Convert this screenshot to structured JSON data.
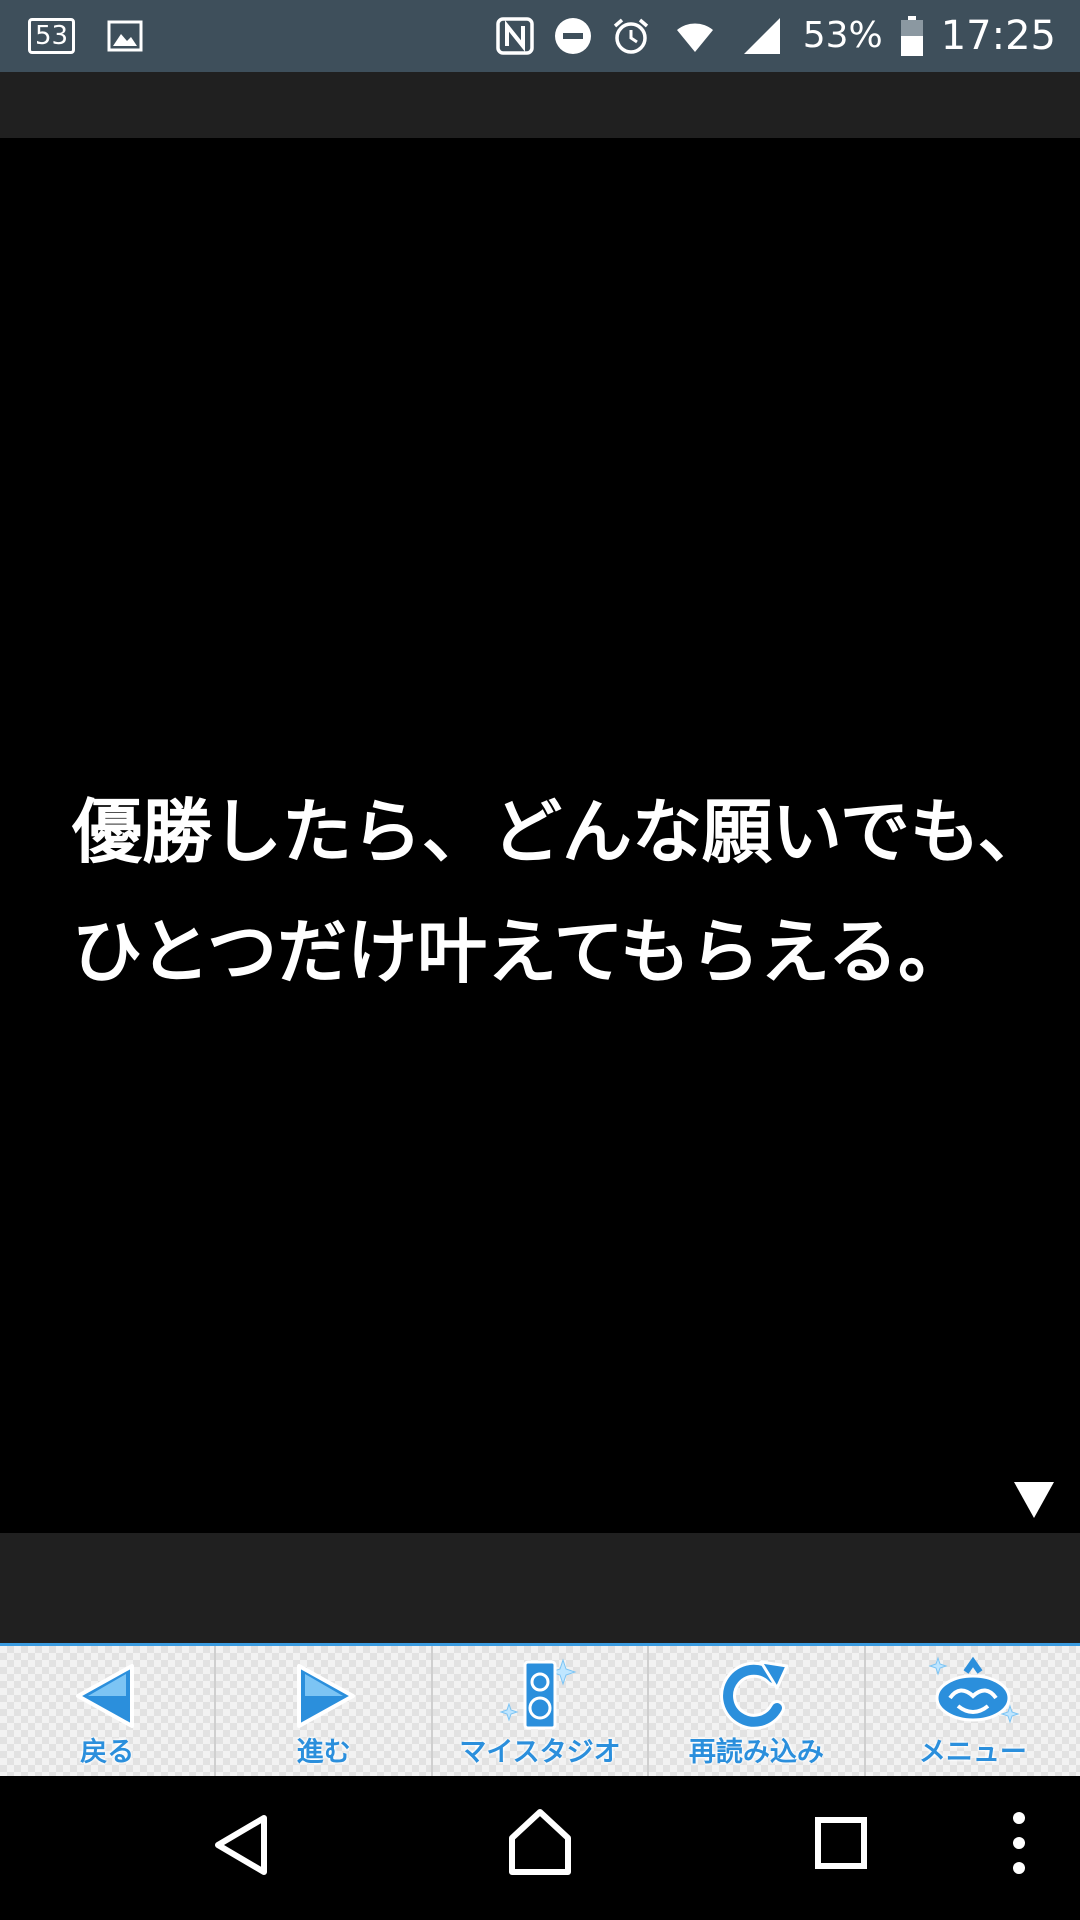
{
  "status_bar": {
    "notification_count": "53",
    "battery_percent": "53%",
    "time": "17:25",
    "icons": [
      "notification-count-icon",
      "gallery-icon",
      "nfc-icon",
      "do-not-disturb-icon",
      "alarm-icon",
      "wifi-icon",
      "signal-icon",
      "battery-icon"
    ]
  },
  "story": {
    "lines": [
      "優勝したら、どんな願いでも、",
      "ひとつだけ叶えてもらえる。"
    ],
    "next_indicator_icon": "triangle-down-icon"
  },
  "toolbar": {
    "accent_color": "#2b8fdc",
    "buttons": [
      {
        "label": "戻る",
        "icon": "arrow-left-icon"
      },
      {
        "label": "進む",
        "icon": "arrow-right-icon"
      },
      {
        "label": "マイスタジオ",
        "icon": "speaker-icon"
      },
      {
        "label": "再読み込み",
        "icon": "reload-icon"
      },
      {
        "label": "メニュー",
        "icon": "menu-logo-icon"
      }
    ]
  },
  "navigation_bar": {
    "buttons": [
      "back-icon",
      "home-icon",
      "recents-icon",
      "more-icon"
    ]
  }
}
